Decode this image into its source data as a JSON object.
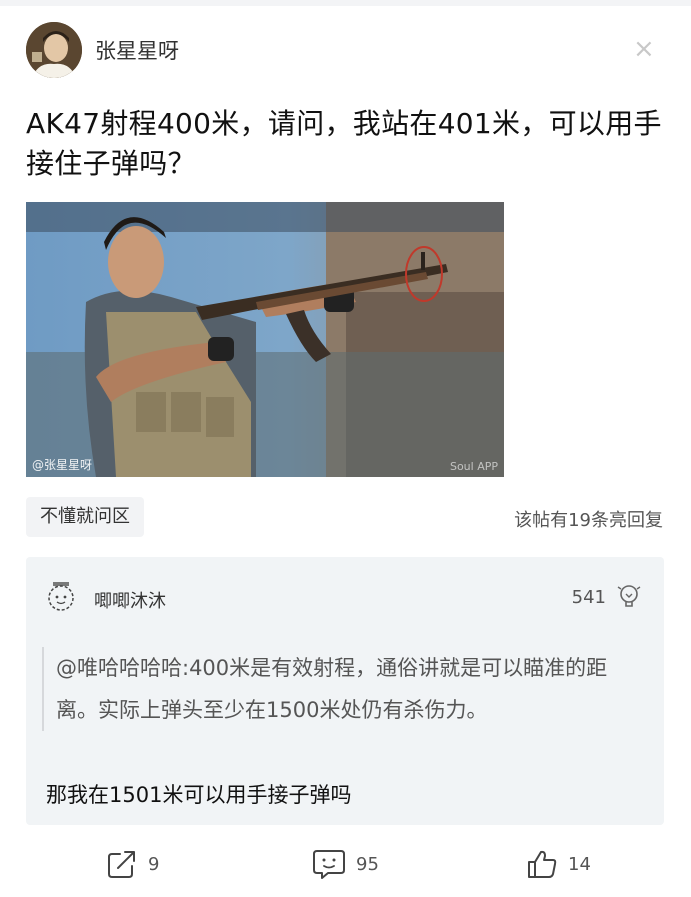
{
  "post": {
    "author": "张星星呀",
    "title": "AK47射程400米，请问，我站在401米，可以用手接住子弹吗？",
    "image": {
      "watermark_left": "@张星星呀",
      "watermark_right": "Soul APP"
    },
    "tag": "不懂就问区",
    "highlight_reply_count": "该帖有19条亮回复"
  },
  "comment": {
    "username": "唧唧沐沐",
    "likes": "541",
    "quote": "@唯哈哈哈哈:400米是有效射程，通俗讲就是可以瞄准的距离。实际上弹头至少在1500米处仍有杀伤力。",
    "reply": "那我在1501米可以用手接子弹吗"
  },
  "footer": {
    "share_count": "9",
    "comment_count": "95",
    "like_count": "14"
  },
  "icons": {
    "close": "close-icon",
    "share": "share-icon",
    "comment": "comment-icon",
    "like": "thumbs-up-icon",
    "bulb": "lightbulb-icon"
  },
  "colors": {
    "tag_bg": "#f2f3f5",
    "card_bg": "#f1f4f6",
    "icon_gray": "#444444",
    "circle_red": "#c0392b"
  }
}
